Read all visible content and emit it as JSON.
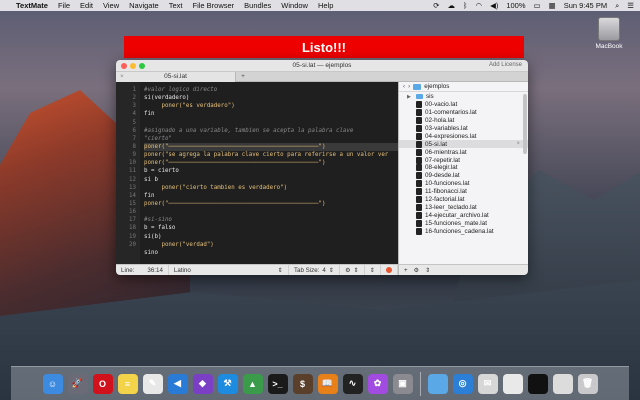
{
  "menubar": {
    "app": "TextMate",
    "items": [
      "File",
      "Edit",
      "View",
      "Navigate",
      "Text",
      "File Browser",
      "Bundles",
      "Window",
      "Help"
    ],
    "battery": "100%",
    "clock": "Sun 9:45 PM"
  },
  "desktop": {
    "drive_label": "MacBook"
  },
  "banner": {
    "text": "Listo!!!",
    "color": "#ee0000"
  },
  "window": {
    "title": "05-si.lat — ejemplos",
    "add_license": "Add License",
    "tab_label": "05-si.lat",
    "tab_add": "+",
    "line_numbers": [
      "1",
      "2",
      "3",
      "4",
      "5",
      "6",
      "7",
      "8",
      "9",
      "10",
      "11",
      "12",
      "13",
      "14",
      "15",
      "16",
      "17",
      "18",
      "19",
      "20"
    ],
    "code_lines": [
      {
        "text": "#valor logico directo",
        "cls": "c-comment"
      },
      {
        "text": "si(verdadero)",
        "cls": "c-kw"
      },
      {
        "text": "     poner(\"es verdadero\")",
        "cls": "c-str"
      },
      {
        "text": "fin",
        "cls": "c-kw"
      },
      {
        "text": "",
        "cls": "c-kw"
      },
      {
        "text": "#asignado a una variable, tambien se acepta la palabra clave",
        "cls": "c-comment"
      },
      {
        "text": "\"cierto\"",
        "cls": "c-comment"
      },
      {
        "text": "poner(\"───────────────────────────────────────────\")",
        "cls": "c-str c-hl"
      },
      {
        "text": "poner(\"se agrega la palabra clave cierto para referirse a un valor ver",
        "cls": "c-str"
      },
      {
        "text": "poner(\"───────────────────────────────────────────\")",
        "cls": "c-str"
      },
      {
        "text": "b = cierto",
        "cls": "c-kw"
      },
      {
        "text": "si b",
        "cls": "c-kw"
      },
      {
        "text": "     poner(\"cierto tambien es verdadero\")",
        "cls": "c-str"
      },
      {
        "text": "fin",
        "cls": "c-kw"
      },
      {
        "text": "poner(\"───────────────────────────────────────────\")",
        "cls": "c-str"
      },
      {
        "text": "",
        "cls": "c-kw"
      },
      {
        "text": "#si-sino",
        "cls": "c-comment"
      },
      {
        "text": "b = falso",
        "cls": "c-kw"
      },
      {
        "text": "si(b)",
        "cls": "c-kw"
      },
      {
        "text": "     poner(\"verdad\")",
        "cls": "c-str"
      },
      {
        "text": "sino",
        "cls": "c-kw"
      }
    ],
    "sidebar": {
      "folder": "ejemplos",
      "items": [
        {
          "label": "sis",
          "type": "folder",
          "selected": false
        },
        {
          "label": "00-vacio.lat",
          "type": "file",
          "selected": false
        },
        {
          "label": "01-comentarios.lat",
          "type": "file",
          "selected": false
        },
        {
          "label": "02-hola.lat",
          "type": "file",
          "selected": false
        },
        {
          "label": "03-variables.lat",
          "type": "file",
          "selected": false
        },
        {
          "label": "04-expresiones.lat",
          "type": "file",
          "selected": false
        },
        {
          "label": "05-si.lat",
          "type": "file",
          "selected": true
        },
        {
          "label": "06-mientras.lat",
          "type": "file",
          "selected": false
        },
        {
          "label": "07-repetir.lat",
          "type": "file",
          "selected": false
        },
        {
          "label": "08-elegir.lat",
          "type": "file",
          "selected": false
        },
        {
          "label": "09-desde.lat",
          "type": "file",
          "selected": false
        },
        {
          "label": "10-funciones.lat",
          "type": "file",
          "selected": false
        },
        {
          "label": "11-fibonacci.lat",
          "type": "file",
          "selected": false
        },
        {
          "label": "12-factorial.lat",
          "type": "file",
          "selected": false
        },
        {
          "label": "13-leer_teclado.lat",
          "type": "file",
          "selected": false
        },
        {
          "label": "14-ejecutar_archivo.lat",
          "type": "file",
          "selected": false
        },
        {
          "label": "15-funciones_mate.lat",
          "type": "file",
          "selected": false
        },
        {
          "label": "16-funciones_cadena.lat",
          "type": "file",
          "selected": false
        }
      ],
      "close_glyph": "×"
    },
    "status": {
      "line_label": "Line:",
      "line_value": "36:14",
      "language": "Latino",
      "tab_size_label": "Tab Size:",
      "tab_size_value": "4"
    }
  },
  "dock": {
    "apps": [
      {
        "name": "finder-icon",
        "glyph": "☺",
        "color": "#3d8be0"
      },
      {
        "name": "launchpad-icon",
        "glyph": "🚀",
        "color": "#6b6b78"
      },
      {
        "name": "opera-icon",
        "glyph": "O",
        "color": "#d1121d"
      },
      {
        "name": "notes-icon",
        "glyph": "≡",
        "color": "#f3d34a"
      },
      {
        "name": "textedit-icon",
        "glyph": "✎",
        "color": "#e8e8e8"
      },
      {
        "name": "vscode-icon",
        "glyph": "◀",
        "color": "#2a7bd6"
      },
      {
        "name": "visual-studio-icon",
        "glyph": "◆",
        "color": "#7b3fc6"
      },
      {
        "name": "xcode-icon",
        "glyph": "⚒",
        "color": "#1c8be0"
      },
      {
        "name": "graphics-app-icon",
        "glyph": "▲",
        "color": "#3a9b4a"
      },
      {
        "name": "terminal-icon",
        "glyph": ">_",
        "color": "#1a1a1a"
      },
      {
        "name": "script-app-icon",
        "glyph": "$",
        "color": "#5a3f2a"
      },
      {
        "name": "ibooks-icon",
        "glyph": "📖",
        "color": "#e8801a"
      },
      {
        "name": "activity-monitor-icon",
        "glyph": "∿",
        "color": "#222"
      },
      {
        "name": "flower-app-icon",
        "glyph": "✿",
        "color": "#a14be0"
      },
      {
        "name": "preview-icon",
        "glyph": "▣",
        "color": "#8a8a90"
      },
      {
        "name": "folder-icon",
        "glyph": "",
        "color": "#5aa9e6"
      },
      {
        "name": "safari-icon",
        "glyph": "◎",
        "color": "#2b7fd6"
      },
      {
        "name": "mail-icon",
        "glyph": "✉",
        "color": "#d7d7d7"
      },
      {
        "name": "window-thumb-1-icon",
        "glyph": "",
        "color": "#e9e9e9"
      },
      {
        "name": "window-thumb-2-icon",
        "glyph": "",
        "color": "#111"
      },
      {
        "name": "window-thumb-3-icon",
        "glyph": "",
        "color": "#dcdcdc"
      },
      {
        "name": "trash-icon",
        "glyph": "🗑",
        "color": "#c9c9cc"
      }
    ]
  }
}
